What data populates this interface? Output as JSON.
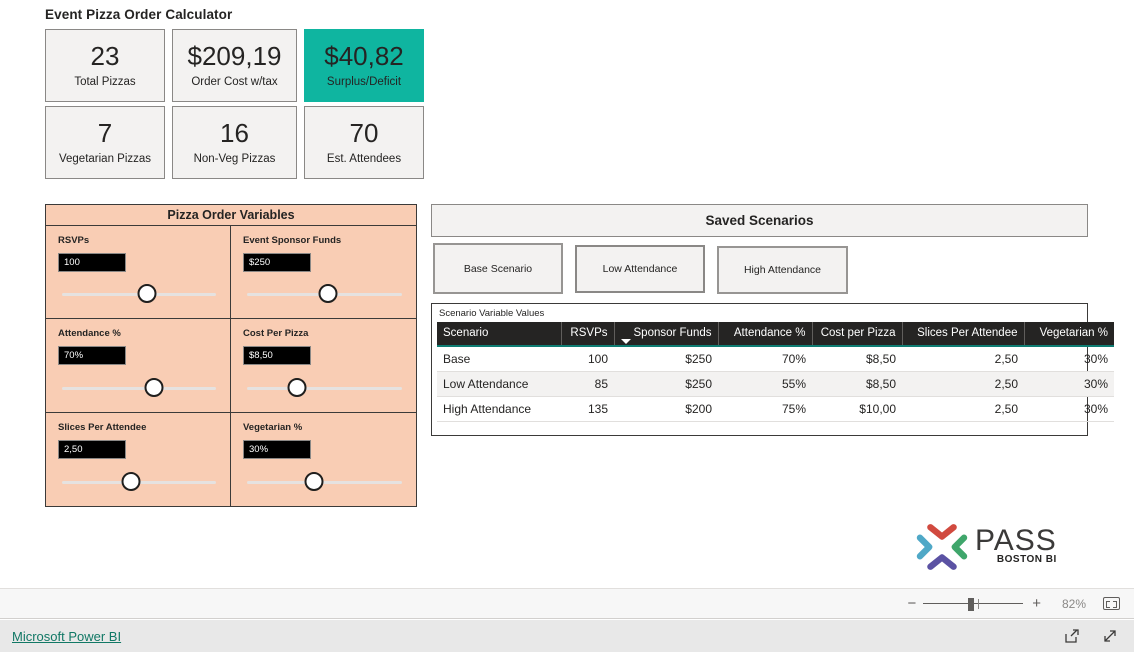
{
  "report": {
    "title": "Event Pizza Order Calculator",
    "accent_color": "#0FB5A0",
    "panel_color": "#F9CDB4"
  },
  "kpis": [
    {
      "value": "23",
      "label": "Total Pizzas",
      "highlight": false
    },
    {
      "value": "$209,19",
      "label": "Order Cost w/tax",
      "highlight": false
    },
    {
      "value": "$40,82",
      "label": "Surplus/Deficit",
      "highlight": true
    },
    {
      "value": "7",
      "label": "Vegetarian Pizzas",
      "highlight": false
    },
    {
      "value": "16",
      "label": "Non-Veg Pizzas",
      "highlight": false
    },
    {
      "value": "70",
      "label": "Est. Attendees",
      "highlight": false
    }
  ],
  "variables_panel": {
    "title": "Pizza Order Variables",
    "items": [
      {
        "label": "RSVPs",
        "value": "100",
        "slider_pct": 55
      },
      {
        "label": "Event Sponsor Funds",
        "value": "$250",
        "slider_pct": 52
      },
      {
        "label": "Attendance %",
        "value": "70%",
        "slider_pct": 60
      },
      {
        "label": "Cost Per Pizza",
        "value": "$8,50",
        "slider_pct": 32
      },
      {
        "label": "Slices Per Attendee",
        "value": "2,50",
        "slider_pct": 45
      },
      {
        "label": "Vegetarian %",
        "value": "30%",
        "slider_pct": 43
      }
    ]
  },
  "scenarios": {
    "title": "Saved Scenarios",
    "buttons": [
      {
        "label": "Base Scenario"
      },
      {
        "label": "Low Attendance"
      },
      {
        "label": "High Attendance"
      }
    ]
  },
  "scenario_table": {
    "caption": "Scenario Variable Values",
    "sorted_column": "Sponsor Funds",
    "sort_direction": "descending",
    "columns": [
      "Scenario",
      "RSVPs",
      "Sponsor Funds",
      "Attendance %",
      "Cost per Pizza",
      "Slices Per Attendee",
      "Vegetarian %"
    ],
    "rows": [
      {
        "scenario": "Base",
        "rsvps": "100",
        "sponsor_funds": "$250",
        "attendance": "70%",
        "cost_per_pizza": "$8,50",
        "slices_per_attendee": "2,50",
        "vegetarian": "30%"
      },
      {
        "scenario": "Low Attendance",
        "rsvps": "85",
        "sponsor_funds": "$250",
        "attendance": "55%",
        "cost_per_pizza": "$8,50",
        "slices_per_attendee": "2,50",
        "vegetarian": "30%"
      },
      {
        "scenario": "High Attendance",
        "rsvps": "135",
        "sponsor_funds": "$200",
        "attendance": "75%",
        "cost_per_pizza": "$10,00",
        "slices_per_attendee": "2,50",
        "vegetarian": "30%"
      }
    ]
  },
  "logo": {
    "name": "PASS",
    "subtitle": "BOSTON BI",
    "colors": [
      "#E07B39",
      "#D14A3F",
      "#3FA66B",
      "#5B52A3",
      "#4FA8C7",
      "#2BA89A"
    ]
  },
  "footer": {
    "zoom_minus": "−",
    "zoom_plus": "+",
    "zoom_level": "82%",
    "fit_icon": "fit-to-page-icon",
    "link_label": "Microsoft Power BI",
    "share_icon": "share-icon",
    "fullscreen_icon": "fullscreen-icon"
  }
}
